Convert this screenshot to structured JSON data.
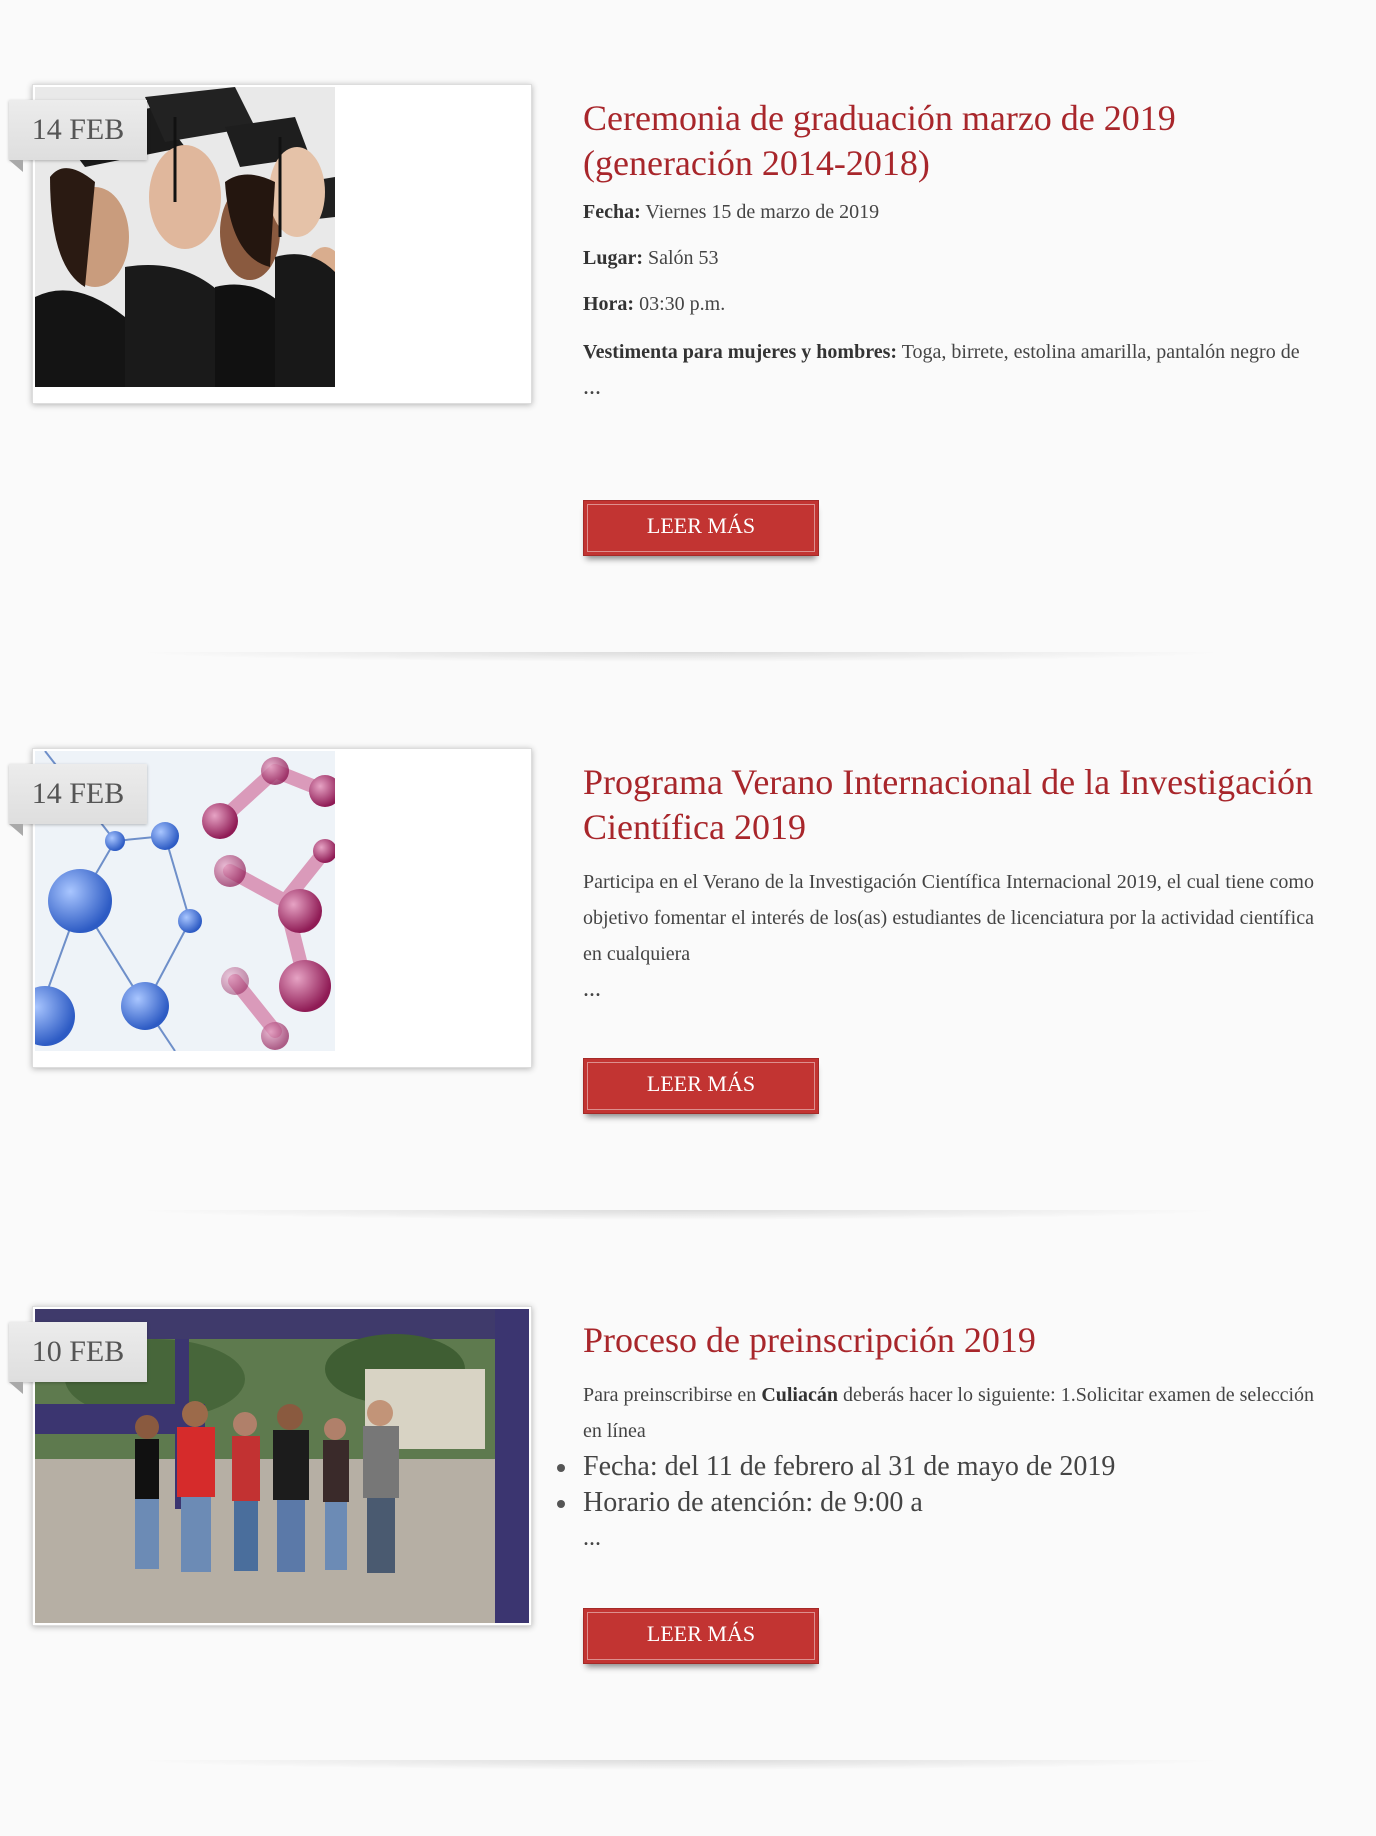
{
  "posts": [
    {
      "date": "14 FEB",
      "title": "Ceremonia de graduación marzo de 2019 (generación 2014-2018)",
      "fields": [
        {
          "label": "Fecha:",
          "value": "Viernes 15 de marzo de 2019"
        },
        {
          "label": "Lugar:",
          "value": "Salón 53"
        },
        {
          "label": "Hora:",
          "value": "03:30 p.m."
        },
        {
          "label": "Vestimenta para mujeres y hombres:",
          "value": "Toga, birrete, estolina amarilla, pantalón negro de"
        }
      ],
      "ellipsis": "...",
      "button": "LEER MÁS"
    },
    {
      "date": "14 FEB",
      "title": "Programa Verano Internacional de la Investigación Científica 2019",
      "summary": "Participa en el Verano de la Investigación Científica Internacional 2019, el cual tiene como objetivo fomentar el interés de los(as) estudiantes de licenciatura por la actividad científica en cualquiera",
      "ellipsis": "...",
      "button": "LEER MÁS"
    },
    {
      "date": "10 FEB",
      "title": "Proceso de preinscripción 2019",
      "summary_pre": "Para preinscribirse en",
      "summary_bold": "Culiacán",
      "summary_post": "deberás hacer lo siguiente: 1.Solicitar examen de selección en línea",
      "bullets": [
        "Fecha: del 11 de febrero al 31 de mayo de 2019",
        "Horario de atención: de 9:00 a"
      ],
      "ellipsis": "...",
      "button": "LEER MÁS"
    }
  ]
}
